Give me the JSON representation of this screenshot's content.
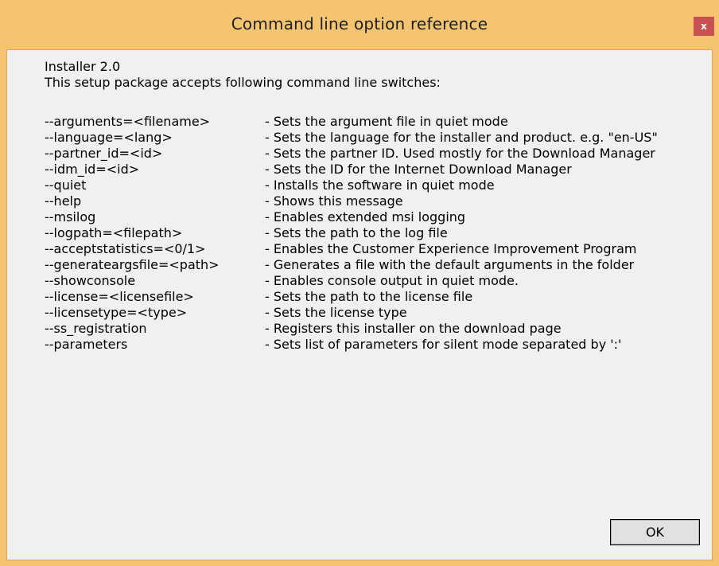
{
  "window": {
    "title": "Command line option reference",
    "close_label": "x"
  },
  "header": {
    "product": "Installer 2.0",
    "intro": "This setup package accepts following command line switches:"
  },
  "options": [
    {
      "name": "--arguments=<filename>",
      "desc": "- Sets the argument file in quiet mode"
    },
    {
      "name": "--language=<lang>",
      "desc": "- Sets the language for the installer and product. e.g. \"en-US\""
    },
    {
      "name": "--partner_id=<id>",
      "desc": "- Sets the partner ID. Used mostly for the Download Manager"
    },
    {
      "name": "--idm_id=<id>",
      "desc": "- Sets the ID for the Internet Download Manager"
    },
    {
      "name": "--quiet",
      "desc": "- Installs the software in quiet mode"
    },
    {
      "name": "--help",
      "desc": "- Shows this message"
    },
    {
      "name": "--msilog",
      "desc": "- Enables extended msi logging"
    },
    {
      "name": "--logpath=<filepath>",
      "desc": "- Sets the path to the log file"
    },
    {
      "name": "--acceptstatistics=<0/1>",
      "desc": "- Enables the Customer Experience Improvement Program"
    },
    {
      "name": "--generateargsfile=<path>",
      "desc": "- Generates a file with the default arguments in the folder"
    },
    {
      "name": "--showconsole",
      "desc": "- Enables console output in quiet mode."
    },
    {
      "name": "--license=<licensefile>",
      "desc": "- Sets the path to the license file"
    },
    {
      "name": "--licensetype=<type>",
      "desc": "- Sets the license type"
    },
    {
      "name": "--ss_registration",
      "desc": "- Registers this installer on the download page"
    },
    {
      "name": "--parameters",
      "desc": "- Sets list of parameters for silent mode separated by ':'"
    }
  ],
  "footer": {
    "ok_label": "OK"
  },
  "colors": {
    "frame": "#f4c471",
    "client": "#f0f0f0",
    "close": "#c75050"
  }
}
